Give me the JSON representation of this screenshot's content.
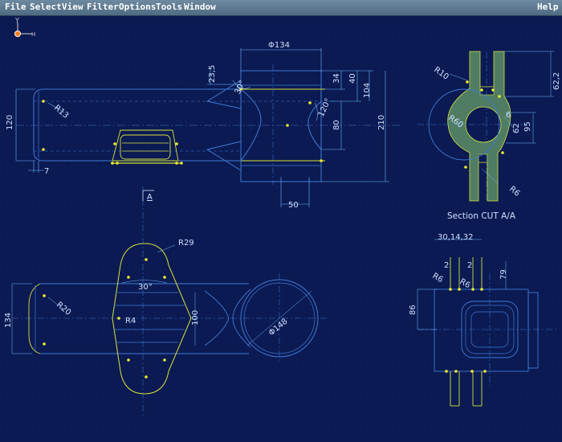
{
  "menubar": {
    "items": [
      "File",
      "Select",
      "View",
      "Filter",
      "Options",
      "Tools",
      "Window"
    ],
    "help": "Help"
  },
  "axis_indicator": {
    "y": "Y",
    "x": "H"
  },
  "colors": {
    "background": "#0b1a52",
    "geometry": "#3f7bd6",
    "highlight": "#d6e23c",
    "dimension": "#6fb7ff",
    "point": "#f2ee2f",
    "section_fill": "#4f7c63",
    "text": "#cfe0ff"
  },
  "front_view": {
    "dim_phi134": "Φ134",
    "dim_23_5": "23,5",
    "dim_30": "30°",
    "dim_34": "34",
    "dim_40": "40",
    "dim_104": "104",
    "dim_120deg": "120°",
    "dim_80": "80",
    "dim_210": "210",
    "dim_120": "120",
    "dim_r13": "R13",
    "dim_7": "7",
    "dim_50": "50"
  },
  "section_view": {
    "dim_r10": "R10",
    "dim_62_2": "62,2",
    "dim_r60": "R60",
    "dim_6": "6",
    "dim_62": "62",
    "dim_95": "95",
    "dim_r6": "R6",
    "caption": "Section CUT A/A"
  },
  "section_marker": {
    "label": "A"
  },
  "top_view": {
    "dim_r29": "R29",
    "dim_30": "30°",
    "dim_134": "134",
    "dim_r20": "R20",
    "dim_r4": "R4",
    "dim_100": "100",
    "dim_phi148": "Φ148"
  },
  "side_view": {
    "dim_30_14_32": "30,14,32",
    "dim_2a": "2",
    "dim_2b": "2",
    "dim_r6a": "R6",
    "dim_r6b": "R6",
    "dim_79": "79",
    "dim_86": "86"
  }
}
